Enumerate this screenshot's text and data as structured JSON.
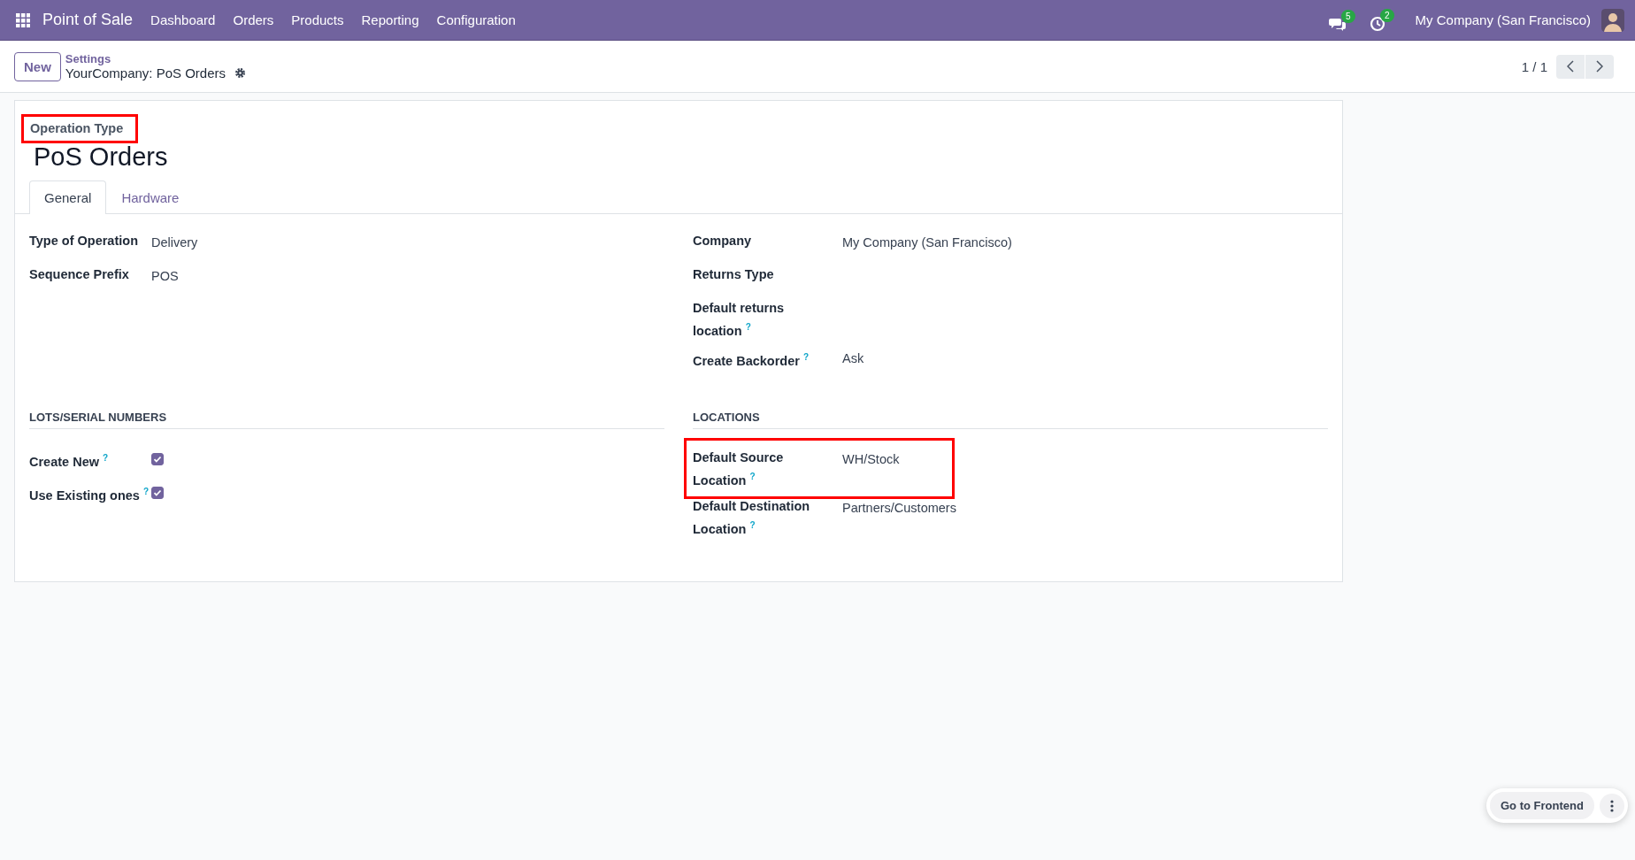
{
  "navbar": {
    "app_name": "Point of Sale",
    "menu": [
      "Dashboard",
      "Orders",
      "Products",
      "Reporting",
      "Configuration"
    ],
    "messages_badge": "5",
    "activities_badge": "2",
    "company": "My Company (San Francisco)"
  },
  "control_panel": {
    "new_button": "New",
    "breadcrumb": "Settings",
    "record_title": "YourCompany: PoS Orders",
    "pager": "1 / 1"
  },
  "form": {
    "label": "Operation Type",
    "label_highlighted": true,
    "title": "PoS Orders",
    "tabs": [
      {
        "label": "General",
        "selected": true
      },
      {
        "label": "Hardware",
        "selected": false
      }
    ],
    "left_fields": [
      {
        "kind": "text",
        "label": "Type of Operation",
        "value": "Delivery"
      },
      {
        "kind": "text",
        "label": "Sequence Prefix",
        "value": "POS"
      }
    ],
    "right_fields": [
      {
        "kind": "text",
        "label": "Company",
        "value": "My Company (San Francisco)"
      },
      {
        "kind": "text",
        "label": "Returns Type"
      },
      {
        "kind": "text",
        "label": "Default returns location",
        "help": "?"
      },
      {
        "kind": "text",
        "label": "Create Backorder",
        "help": "?",
        "value": "Ask"
      }
    ],
    "left_section": {
      "title": "LOTS/SERIAL NUMBERS",
      "fields": [
        {
          "kind": "checkbox",
          "label": "Create New",
          "help": "?",
          "checked": true
        },
        {
          "kind": "checkbox",
          "label": "Use Existing ones",
          "help": "?",
          "checked": true
        }
      ]
    },
    "right_section": {
      "title": "LOCATIONS",
      "fields": [
        {
          "kind": "text",
          "label": "Default Source Location",
          "help": "?",
          "value": "WH/Stock",
          "highlighted": true
        },
        {
          "kind": "text",
          "label": "Default Destination Location",
          "help": "?",
          "value": "Partners/Customers"
        }
      ]
    }
  },
  "floating": {
    "button": "Go to Frontend"
  }
}
